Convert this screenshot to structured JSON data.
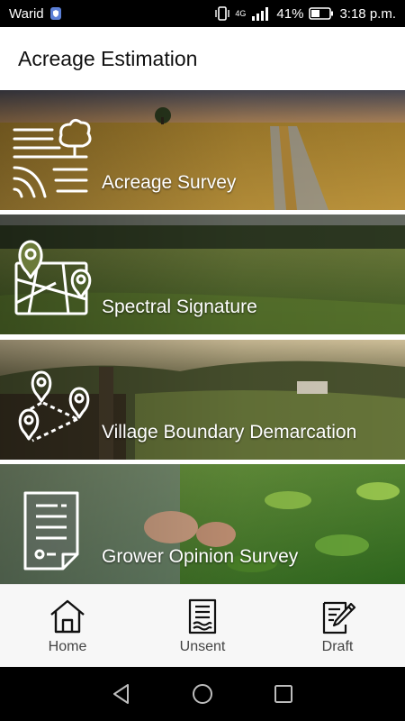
{
  "status_bar": {
    "carrier": "Warid",
    "network": "4G",
    "battery": "41%",
    "time": "3:18 p.m."
  },
  "app": {
    "title": "Acreage Estimation"
  },
  "menu": [
    {
      "label": "Acreage Survey",
      "icon": "field-tree-icon"
    },
    {
      "label": "Spectral Signature",
      "icon": "map-pins-icon"
    },
    {
      "label": "Village Boundary Demarcation",
      "icon": "boundary-pins-icon"
    },
    {
      "label": "Grower Opinion Survey",
      "icon": "document-icon"
    }
  ],
  "bottom_nav": [
    {
      "label": "Home",
      "icon": "home-icon"
    },
    {
      "label": "Unsent",
      "icon": "unsent-doc-icon"
    },
    {
      "label": "Draft",
      "icon": "draft-edit-icon"
    }
  ]
}
